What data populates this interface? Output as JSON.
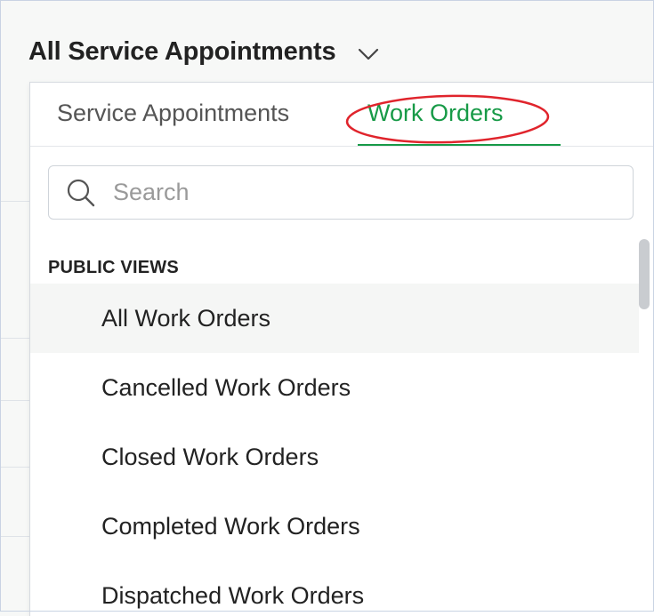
{
  "header": {
    "title": "All Service Appointments",
    "chevron_icon": "chevron-down-icon"
  },
  "dropdown": {
    "tabs": [
      {
        "label": "Service Appointments",
        "active": false
      },
      {
        "label": "Work Orders",
        "active": true
      }
    ],
    "search": {
      "placeholder": "Search",
      "value": "",
      "icon": "search-icon"
    },
    "section_heading": "PUBLIC VIEWS",
    "items": [
      {
        "label": "All Work Orders",
        "selected": true
      },
      {
        "label": "Cancelled Work Orders",
        "selected": false
      },
      {
        "label": "Closed Work Orders",
        "selected": false
      },
      {
        "label": "Completed Work Orders",
        "selected": false
      },
      {
        "label": "Dispatched Work Orders",
        "selected": false
      }
    ]
  },
  "colors": {
    "accent_green": "#179a47",
    "annotation_red": "#e0242c",
    "selected_row_bg": "#f5f6f5"
  }
}
